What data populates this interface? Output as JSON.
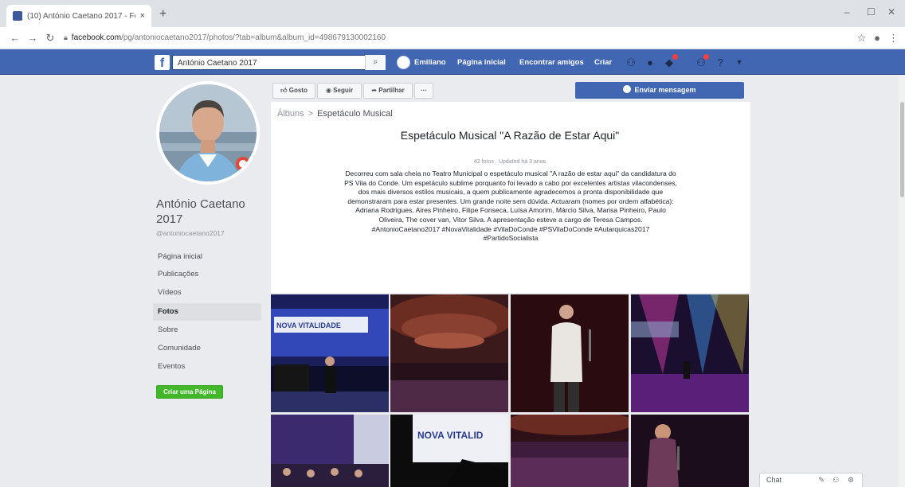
{
  "browser": {
    "tab_title": "(10) António Caetano 2017 - Fo",
    "tab_close": "×",
    "new_tab": "+",
    "url_host": "facebook.com",
    "url_path": "/pg/antoniocaetano2017/photos/?tab=album&album_id=498679130002160",
    "window_min": "–",
    "window_max": "☐",
    "window_close": "✕"
  },
  "facebook": {
    "logo": "f",
    "search_value": "António Caetano 2017",
    "nav_profile": "Emiliano",
    "nav_home": "Página inicial",
    "nav_find_friends": "Encontrar amigos",
    "nav_create": "Criar"
  },
  "sidebar": {
    "page_name": "António Caetano 2017",
    "page_handle": "@antoniocaetano2017",
    "items": [
      {
        "label": "Página inicial"
      },
      {
        "label": "Publicações"
      },
      {
        "label": "Vídeos"
      },
      {
        "label": "Fotos"
      },
      {
        "label": "Sobre"
      },
      {
        "label": "Comunidade"
      },
      {
        "label": "Eventos"
      }
    ],
    "create_page": "Criar uma Página"
  },
  "actions": {
    "like": "Gosto",
    "follow": "Seguir",
    "share": "Partilhar",
    "more": "···",
    "send_message": "Enviar mensagem"
  },
  "album": {
    "breadcrumb_root": "Álbuns",
    "breadcrumb_sep": ">",
    "breadcrumb_current": "Espetáculo Musical",
    "title": "Espetáculo Musical \"A Razão de Estar Aqui\"",
    "meta": "42 fotos · Updated há 3 anos",
    "description": "Decorreu com sala cheia no Teatro Municipal o espetáculo musical \"A razão de estar aqui\" da candidatura do PS Vila do Conde. Um espetáculo sublime porquanto foi levado a cabo por excelentes artistas vilacondenses, dos mais diversos estilos musicais, a quem publicamente agradecemos a pronta disponibilidade que demonstraram para estar presentes. Um grande noite sem dúvida. Actuaram (nomes por ordem alfabética): Adriana Rodrigues, Aires Pinheiro, Filipe Fonseca, Luísa Amorim, Márcio Silva, Marisa Pinheiro, Paulo Oliveira, The cover van, Vitor Silva. A apresentação esteve a cargo de Teresa Campos. #AntonioCaetano2017 #NovaVitalidade #VilaDoConde #PSVilaDoConde #Autarquicas2017 #PartidoSocialista",
    "photo_banner_1": "NOVA VITALIDADE",
    "photo_banner_2": "NOVA VITALID",
    "photo_banner_3": "NOVA VITALIDADE"
  },
  "chat": {
    "label": "Chat",
    "icons": "✎ ⚇ ⚙"
  }
}
